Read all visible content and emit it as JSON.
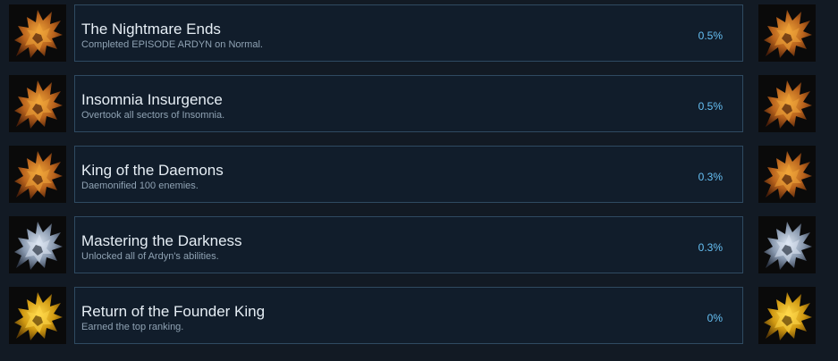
{
  "achievements": [
    {
      "title": "The Nightmare Ends",
      "description": "Completed EPISODE ARDYN on Normal.",
      "percent": "0.5%",
      "icon": "flame-daemon-icon",
      "tint": "bronze"
    },
    {
      "title": "Insomnia Insurgence",
      "description": "Overtook all sectors of Insomnia.",
      "percent": "0.5%",
      "icon": "flame-daemon-icon",
      "tint": "bronze"
    },
    {
      "title": "King of the Daemons",
      "description": "Daemonified 100 enemies.",
      "percent": "0.3%",
      "icon": "flame-daemon-icon",
      "tint": "bronze"
    },
    {
      "title": "Mastering the Darkness",
      "description": "Unlocked all of Ardyn's abilities.",
      "percent": "0.3%",
      "icon": "flame-daemon-icon",
      "tint": "silver"
    },
    {
      "title": "Return of the Founder King",
      "description": "Earned the top ranking.",
      "percent": "0%",
      "icon": "flame-daemon-icon",
      "tint": "gold"
    }
  ],
  "tints": {
    "bronze": {
      "light": "#f0a63a",
      "mid": "#b8621c",
      "dark": "#4a1e08"
    },
    "silver": {
      "light": "#dce6f2",
      "mid": "#8898ae",
      "dark": "#2a3342"
    },
    "gold": {
      "light": "#ffd84a",
      "mid": "#d19a12",
      "dark": "#5a3a04"
    }
  }
}
